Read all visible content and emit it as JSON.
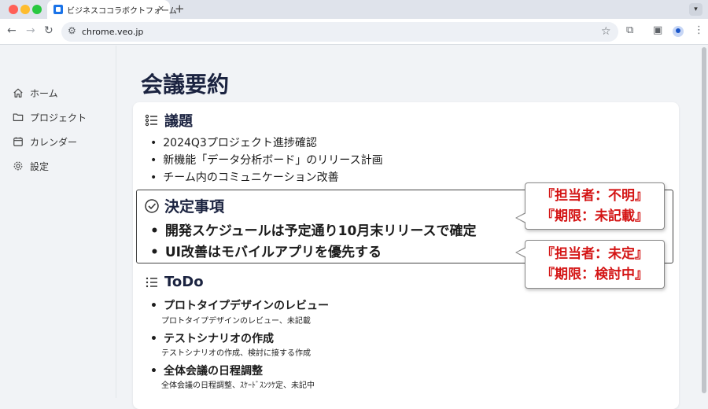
{
  "browser": {
    "tab_title": "ビジネスココラボクトフォーム",
    "tab_close": "×",
    "new_tab": "+",
    "url": "chrome.veo.jp"
  },
  "sidebar": {
    "items": [
      {
        "label": "ホーム",
        "icon": "home-icon"
      },
      {
        "label": "プロジェクト",
        "icon": "folder-icon"
      },
      {
        "label": "カレンダー",
        "icon": "calendar-icon"
      },
      {
        "label": "設定",
        "icon": "gear-icon"
      }
    ]
  },
  "page": {
    "title": "会議要約"
  },
  "agenda": {
    "title": "議題",
    "items": [
      "2024Q3プロジェクト進捗確認",
      "新機能「データ分析ボード」のリリース計画",
      "チーム内のコミュニケーション改善"
    ]
  },
  "decisions": {
    "title": "決定事項",
    "items": [
      "開発スケジュールは予定通り10月末リリースで確定",
      "UI改善はモバイルアプリを優先する"
    ]
  },
  "callouts": [
    {
      "line1": "『担当者：不明』",
      "line2": "『期限：未記載』"
    },
    {
      "line1": "『担当者：未定』",
      "line2": "『期限：検討中』"
    }
  ],
  "todo": {
    "title": "ToDo",
    "items": [
      {
        "title": "プロトタイプデザインのレビュー",
        "detail": "プロトタイプデザインのレビュー、未記載"
      },
      {
        "title": "テストシナリオの作成",
        "detail": "テストシナリオの作成、検討に接する作成"
      },
      {
        "title": "全体会議の日程調整",
        "detail": "全体会議の日程調整、ｽｹｰﾄﾞｽﾝﾂｹ定、未記中"
      }
    ]
  },
  "colors": {
    "accent_red": "#d41515",
    "title_navy": "#1b2340"
  }
}
